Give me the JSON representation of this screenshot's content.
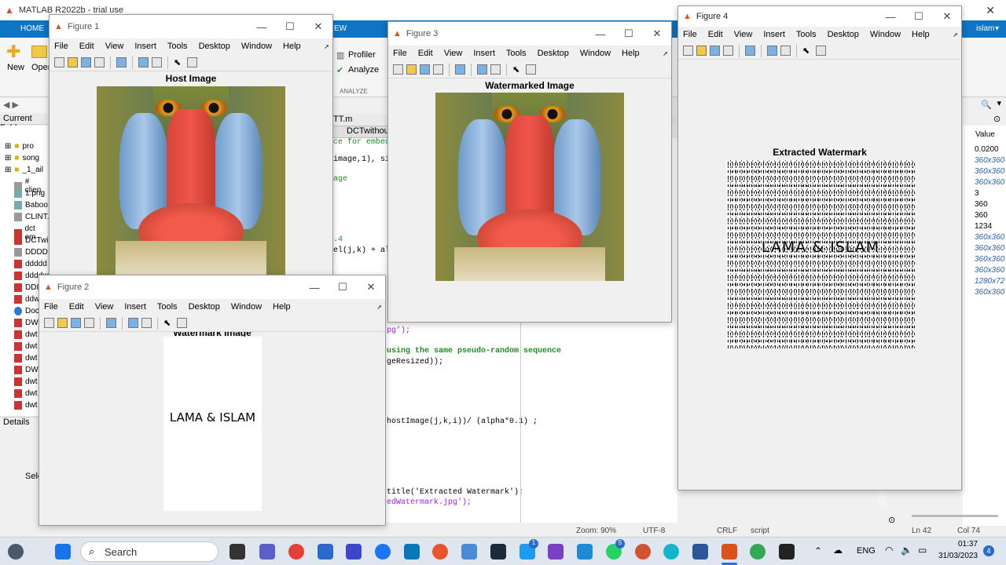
{
  "matlab": {
    "title": "MATLAB R2022b - trial use",
    "home_tab": "HOME",
    "view_tab": "EW",
    "new": "New",
    "open": "Open",
    "profiler": "Profiler",
    "analyze": "Analyze",
    "analyze_group": "ANALYZE",
    "user": "islam",
    "current_folder": "Current Folde",
    "details": "Details",
    "sele": "Sele",
    "file_tab1": "TT.m",
    "file_tab2": "DCTwithout",
    "value_header": "Value",
    "ln": "Ln  42",
    "col": "Col  74",
    "zoom": "Zoom: 90%",
    "encoding": "UTF-8",
    "eol": "CRLF",
    "type": "script"
  },
  "files": [
    "pro",
    "song",
    "_1_ail",
    "# clien",
    "1.png",
    "Baboo",
    "CLINT.",
    "dct em",
    "DCTwi",
    "DDDD",
    "ddddd",
    "ddddwt",
    "DDI",
    "ddwi",
    "Doc",
    "DW",
    "dwt",
    "dwt",
    "dwt",
    "DW",
    "dwt",
    "dwt",
    "dwt",
    "dwt"
  ],
  "values": [
    "0.0200",
    "360x360",
    "360x360",
    "360x360",
    "3",
    "360",
    "360",
    "1234",
    "360x360",
    "360x360",
    "360x360",
    "360x360",
    "1280x72",
    "360x360"
  ],
  "code": {
    "l1": "ce for embed",
    "l2": "image,1), siz",
    "l3": "age",
    "l4": ".4",
    "l5": "el(j,k) + alp",
    "l6": "pg');",
    "l7": "using the same pseudo-random sequence",
    "l8": "geResized));",
    "l9": "hostImage(j,k,i))/ (alpha*0.1) ;",
    "l10": "title('Extracted Watermark');",
    "l11": "edWatermark.jpg');"
  },
  "menu": [
    "File",
    "Edit",
    "View",
    "Insert",
    "Tools",
    "Desktop",
    "Window",
    "Help"
  ],
  "fig1": {
    "title": "Figure 1",
    "axes_title": "Host Image"
  },
  "fig2": {
    "title": "Figure 2",
    "axes_title": "Watermark Image",
    "text": "LAMA & ISLAM"
  },
  "fig3": {
    "title": "Figure 3",
    "axes_title": "Watermarked Image"
  },
  "fig4": {
    "title": "Figure 4",
    "axes_title": "Extracted Watermark",
    "text": "LAMA & ISLAM"
  },
  "taskbar": {
    "search": "Search",
    "lang": "ENG",
    "time": "01:37",
    "date": "31/03/2023",
    "badge_twitter": "1",
    "badge_whatsapp": "5",
    "badge_notif": "4"
  }
}
